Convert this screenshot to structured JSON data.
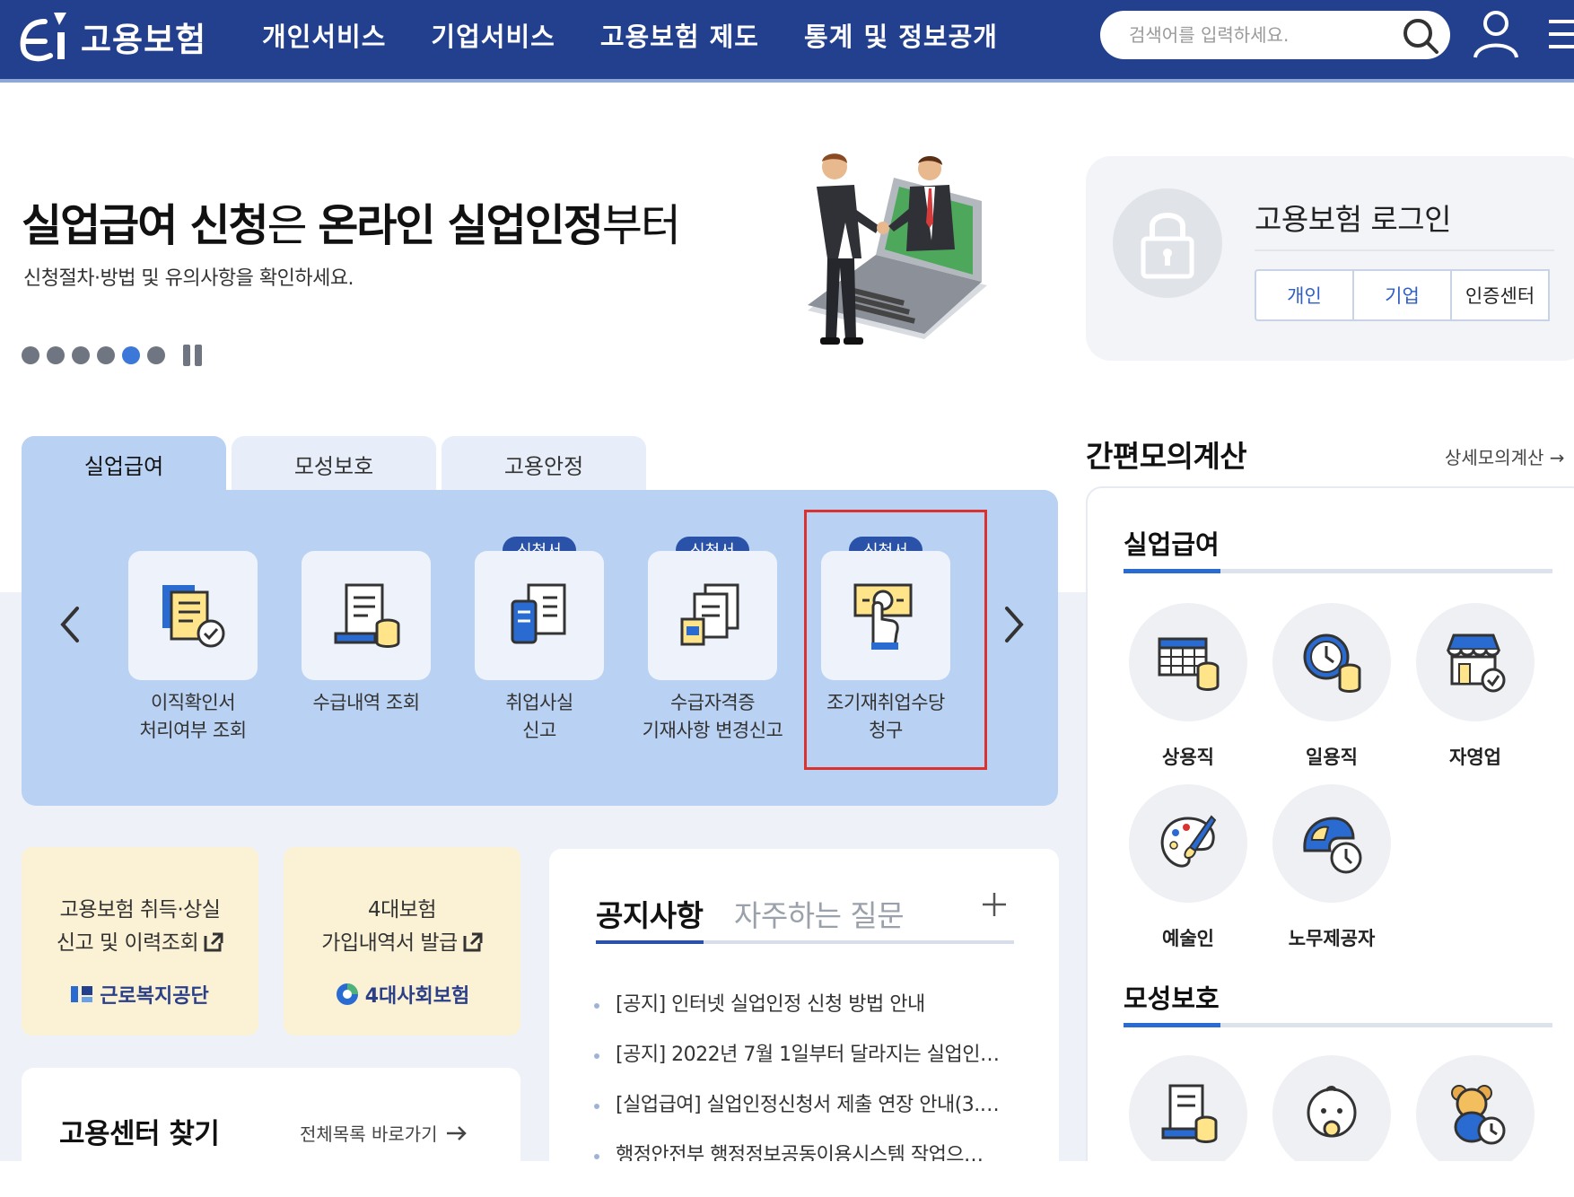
{
  "header": {
    "logo_text": "고용보험",
    "nav": [
      "개인서비스",
      "기업서비스",
      "고용보험 제도",
      "통계 및 정보공개"
    ],
    "search_placeholder": "검색어를 입력하세요."
  },
  "hero": {
    "title_bold1": "실업급여 신청",
    "title_light1": "은 ",
    "title_bold2": "온라인 실업인정",
    "title_light2": "부터",
    "subtitle": "신청절차·방법 및 유의사항을 확인하세요.",
    "slide_count": 6,
    "active_slide": 5
  },
  "login": {
    "title": "고용보험 로그인",
    "buttons": [
      "개인",
      "기업",
      "인증센터"
    ]
  },
  "tabs": [
    "실업급여",
    "모성보호",
    "고용안정"
  ],
  "active_tab": 0,
  "services": [
    {
      "label": "이직확인서\n처리여부 조회",
      "badge": ""
    },
    {
      "label": "수급내역 조회",
      "badge": ""
    },
    {
      "label": "취업사실\n신고",
      "badge": "신청서"
    },
    {
      "label": "수급자격증\n기재사항 변경신고",
      "badge": "신청서"
    },
    {
      "label": "조기재취업수당\n청구",
      "badge": "신청서"
    }
  ],
  "quick_cards": [
    {
      "line1": "고용보험 취득·상실",
      "line2": "신고 및 이력조회",
      "org": "근로복지공단"
    },
    {
      "line1": "4대보험",
      "line2": "가입내역서 발급",
      "org": "4대사회보험"
    }
  ],
  "center": {
    "title": "고용센터 찾기",
    "link": "전체목록 바로가기"
  },
  "notice": {
    "tabs": [
      "공지사항",
      "자주하는 질문"
    ],
    "items": [
      "[공지] 인터넷 실업인정 신청 방법 안내",
      "[공지] 2022년 7월 1일부터 달라지는 실업인…",
      "[실업급여] 실업인정신청서 제출 연장 안내(3.…",
      "행정안전부 행정정보공동이용시스템 작업으…"
    ]
  },
  "simulator": {
    "title": "간편모의계산",
    "link": "상세모의계산 →",
    "section1": "실업급여",
    "items1": [
      "상용직",
      "일용직",
      "자영업",
      "예술인",
      "노무제공자"
    ],
    "section2": "모성보호"
  },
  "colors": {
    "header_bg": "#23408e",
    "tab_panel": "#b9d1f2",
    "badge": "#2a52a8",
    "highlight": "#d9322f",
    "quick_card": "#fbf1d5"
  }
}
